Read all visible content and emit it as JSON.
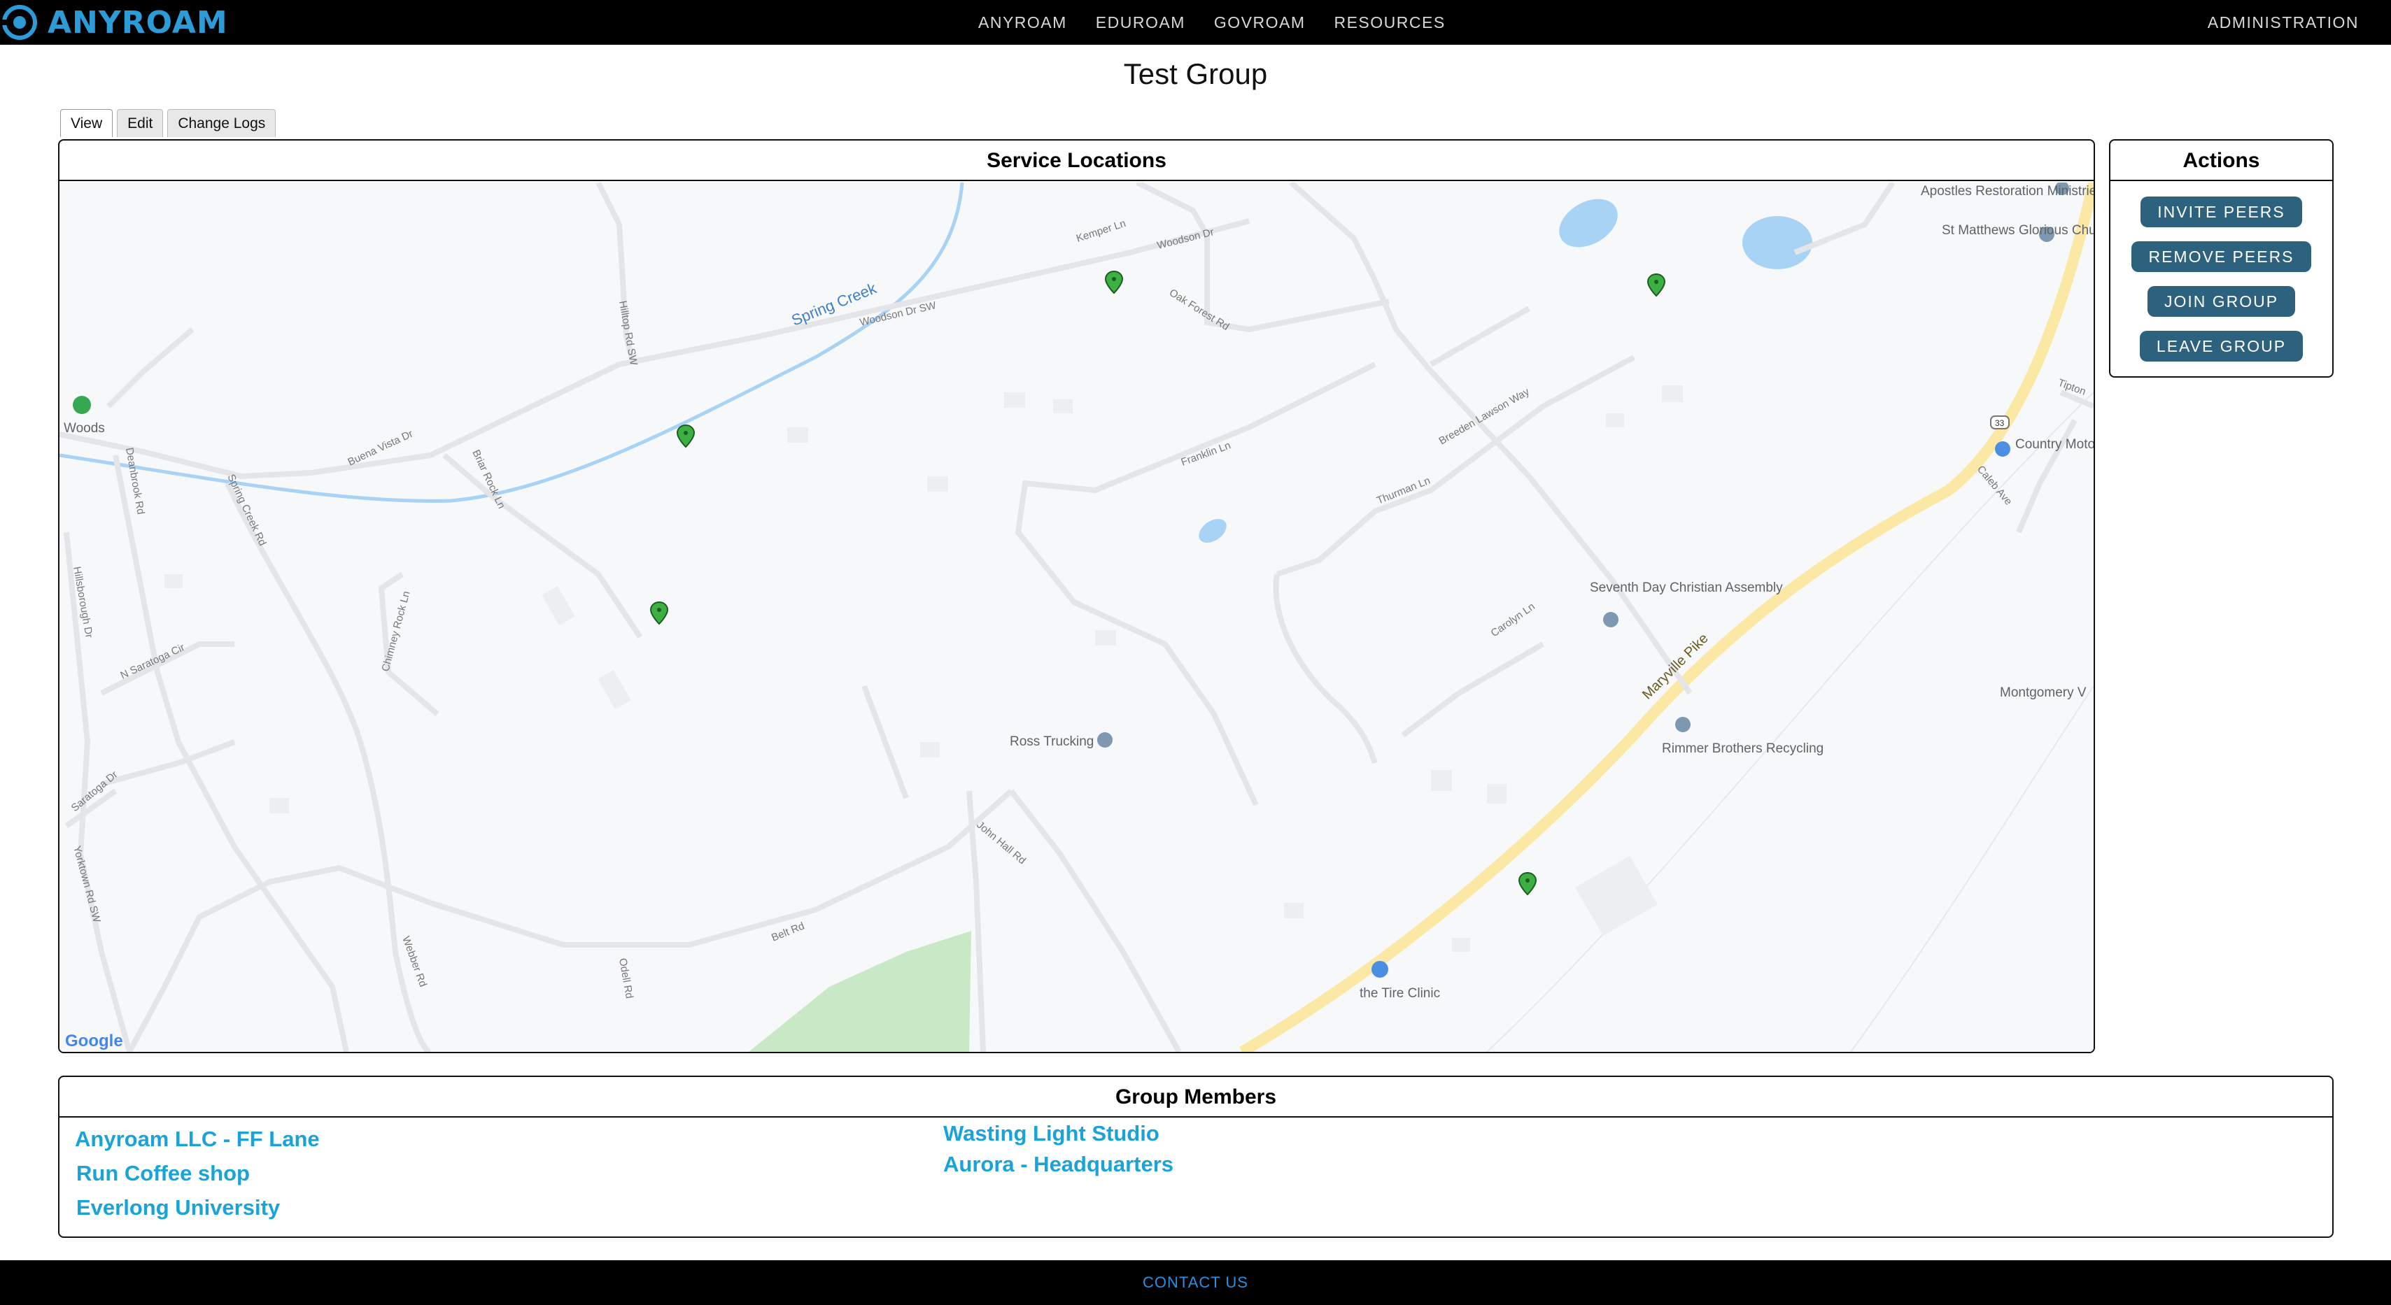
{
  "brand": {
    "name": "ANYROAM",
    "color": "#2b9cd8"
  },
  "nav": {
    "items": [
      "ANYROAM",
      "EDUROAM",
      "GOVROAM",
      "RESOURCES"
    ],
    "admin": "ADMINISTRATION"
  },
  "page": {
    "title": "Test Group"
  },
  "tabs": [
    "View",
    "Edit",
    "Change Logs"
  ],
  "service_locations": {
    "title": "Service Locations",
    "map": {
      "attribution": "Google",
      "streets": [
        "Woodson Dr",
        "Woodson Dr SW",
        "Kemper Ln",
        "Oak Forest Rd",
        "Franklin Ln",
        "Breeden Lawson Way",
        "Thurman Ln",
        "Carolyn Ln",
        "Belt Rd",
        "John Hall Rd",
        "Spring Creek Rd",
        "Deanbrook Rd",
        "N Saratoga Cir",
        "Saratoga Dr",
        "Yorktown Rd SW",
        "Chimney Rock Ln",
        "Briar Rock Ln",
        "Buena Vista Dr",
        "Hilltop Rd SW",
        "Maryville Pike",
        "Webber Rd",
        "Hillsborough Dr",
        "Odell Rd",
        "Caleb Ave",
        "Tipton"
      ],
      "water": [
        "Spring Creek"
      ],
      "pois": [
        "Woods",
        "Ross Trucking",
        "Seventh Day Christian Assembly",
        "Rimmer Brothers Recycling",
        "the Tire Clinic",
        "Country Motor Auto Sales",
        "St Matthews Glorious Church",
        "Apostles Restoration Ministries",
        "Montgomery V"
      ],
      "route_marker": "33",
      "marker_count": 5,
      "marker_color": "#3cb043"
    }
  },
  "actions": {
    "title": "Actions",
    "buttons": [
      "INVITE PEERS",
      "REMOVE PEERS",
      "JOIN GROUP",
      "LEAVE GROUP"
    ],
    "button_color": "#2d627f"
  },
  "members": {
    "title": "Group Members",
    "col1": [
      "Anyroam LLC - FF  Lane",
      "Run Coffee shop",
      "Everlong University"
    ],
    "col2": [
      "Wasting Light Studio",
      "Aurora - Headquarters"
    ],
    "link_color": "#1aa3d8"
  },
  "footer": {
    "contact": "CONTACT US"
  }
}
